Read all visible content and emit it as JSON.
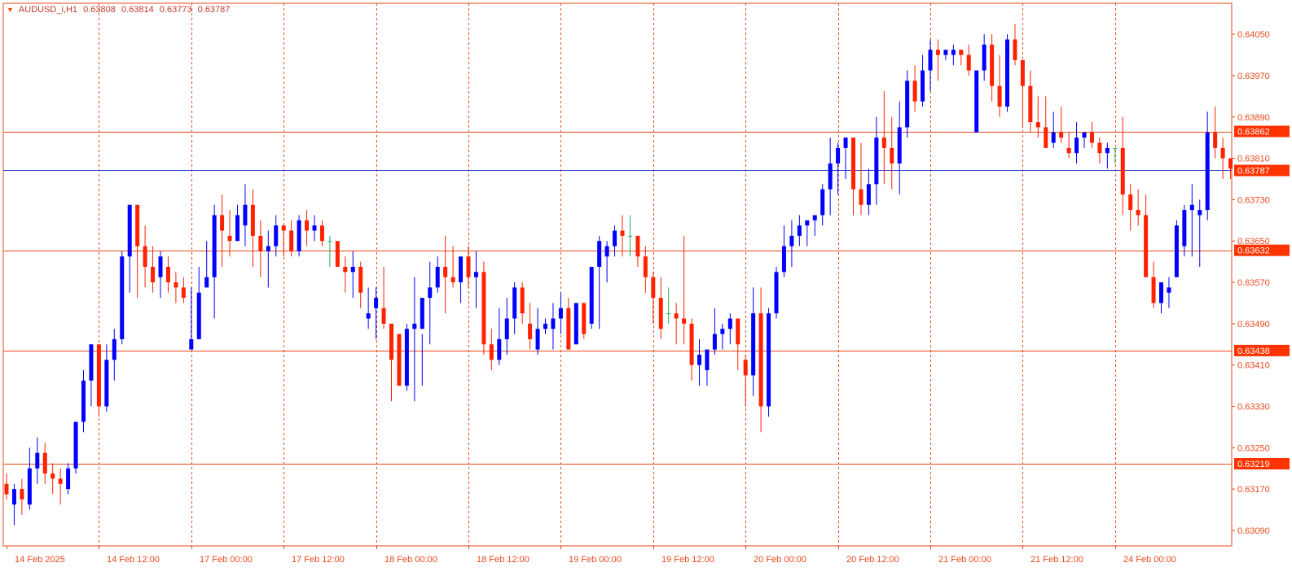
{
  "chart_header": {
    "symbol": "AUDUSD_i,H1",
    "open": "0.63808",
    "high": "0.63814",
    "low": "0.63773",
    "close": "0.63787",
    "collapse_icon": "triangle-down-icon"
  },
  "colors": {
    "background": "#ffffff",
    "frame": "#e8491d",
    "bull": "#0000ff",
    "bear": "#ff2200",
    "neutral": "#27ae60",
    "axis_text": "#e8491d",
    "level_line": "#e8491d",
    "price_line": "#3344cc",
    "badge_bg": "#ff3300",
    "badge_text": "#ffffff"
  },
  "chart_data": {
    "type": "candlestick",
    "x_labels": [
      "14 Feb 2025",
      "14 Feb 12:00",
      "17 Feb 00:00",
      "17 Feb 12:00",
      "18 Feb 00:00",
      "18 Feb 12:00",
      "19 Feb 00:00",
      "19 Feb 12:00",
      "20 Feb 00:00",
      "20 Feb 12:00",
      "21 Feb 00:00",
      "21 Feb 12:00",
      "24 Feb 00:00"
    ],
    "separator_indices": [
      12,
      24,
      36,
      48,
      60,
      72,
      84,
      96,
      108,
      120,
      132,
      144
    ],
    "y_ticks": [
      "0.63090",
      "0.63170",
      "0.63250",
      "0.63330",
      "0.63410",
      "0.63490",
      "0.63570",
      "0.63650",
      "0.63730",
      "0.63810",
      "0.63890",
      "0.63970",
      "0.64050"
    ],
    "ylim": [
      0.6306,
      0.6411
    ],
    "levels": [
      "0.63862",
      "0.63632",
      "0.63438",
      "0.63219"
    ],
    "current_price": "0.63787",
    "candles": [
      [
        0.6318,
        0.632,
        0.6315,
        0.6316
      ],
      [
        0.6314,
        0.6318,
        0.631,
        0.6317
      ],
      [
        0.6317,
        0.6319,
        0.6312,
        0.6315
      ],
      [
        0.6314,
        0.6325,
        0.6313,
        0.6321
      ],
      [
        0.6321,
        0.6327,
        0.6318,
        0.6324
      ],
      [
        0.6324,
        0.6326,
        0.6318,
        0.632
      ],
      [
        0.632,
        0.6322,
        0.6316,
        0.6319
      ],
      [
        0.6319,
        0.6321,
        0.6314,
        0.6318
      ],
      [
        0.6317,
        0.6322,
        0.6316,
        0.6321
      ],
      [
        0.6321,
        0.633,
        0.632,
        0.633
      ],
      [
        0.633,
        0.634,
        0.6328,
        0.6338
      ],
      [
        0.6338,
        0.6345,
        0.6333,
        0.6345
      ],
      [
        0.6345,
        0.6342,
        0.6331,
        0.6333
      ],
      [
        0.6333,
        0.6345,
        0.6332,
        0.6342
      ],
      [
        0.6342,
        0.6348,
        0.6338,
        0.6346
      ],
      [
        0.6346,
        0.6363,
        0.6345,
        0.6362
      ],
      [
        0.6362,
        0.6372,
        0.6355,
        0.6372
      ],
      [
        0.6372,
        0.637,
        0.6354,
        0.6364
      ],
      [
        0.6364,
        0.6368,
        0.6356,
        0.636
      ],
      [
        0.636,
        0.6364,
        0.6355,
        0.6357
      ],
      [
        0.6358,
        0.6363,
        0.6354,
        0.6362
      ],
      [
        0.636,
        0.6362,
        0.6355,
        0.6357
      ],
      [
        0.6357,
        0.6359,
        0.6353,
        0.6356
      ],
      [
        0.6356,
        0.6358,
        0.6353,
        0.6354
      ],
      [
        0.6344,
        0.6356,
        0.6345,
        0.6346
      ],
      [
        0.6346,
        0.636,
        0.6348,
        0.6355
      ],
      [
        0.6356,
        0.6365,
        0.6358,
        0.6358
      ],
      [
        0.6358,
        0.6372,
        0.635,
        0.637
      ],
      [
        0.637,
        0.6374,
        0.636,
        0.6367
      ],
      [
        0.6366,
        0.6371,
        0.6362,
        0.6365
      ],
      [
        0.6365,
        0.6372,
        0.6365,
        0.637
      ],
      [
        0.6368,
        0.6376,
        0.6364,
        0.6372
      ],
      [
        0.6372,
        0.6375,
        0.636,
        0.6366
      ],
      [
        0.6366,
        0.6369,
        0.6358,
        0.6363
      ],
      [
        0.6363,
        0.6367,
        0.6356,
        0.6364
      ],
      [
        0.6364,
        0.637,
        0.6362,
        0.6368
      ],
      [
        0.6368,
        0.6367,
        0.6362,
        0.6367
      ],
      [
        0.6367,
        0.6369,
        0.6362,
        0.6363
      ],
      [
        0.6363,
        0.637,
        0.6362,
        0.6369
      ],
      [
        0.6369,
        0.6371,
        0.6364,
        0.6367
      ],
      [
        0.6367,
        0.637,
        0.6365,
        0.6368
      ],
      [
        0.6368,
        0.6369,
        0.6364,
        0.6365
      ],
      [
        0.6365,
        0.6366,
        0.636,
        0.6365
      ],
      [
        0.6365,
        0.6362,
        0.636,
        0.636
      ],
      [
        0.636,
        0.6362,
        0.6355,
        0.6359
      ],
      [
        0.6359,
        0.6363,
        0.6354,
        0.636
      ],
      [
        0.636,
        0.6361,
        0.6352,
        0.6355
      ],
      [
        0.635,
        0.6356,
        0.6348,
        0.6351
      ],
      [
        0.6352,
        0.6356,
        0.6346,
        0.6354
      ],
      [
        0.6352,
        0.636,
        0.6348,
        0.6349
      ],
      [
        0.6349,
        0.6346,
        0.6334,
        0.6342
      ],
      [
        0.6347,
        0.6347,
        0.6337,
        0.6337
      ],
      [
        0.6337,
        0.6349,
        0.6336,
        0.6348
      ],
      [
        0.6348,
        0.6358,
        0.6334,
        0.6349
      ],
      [
        0.6348,
        0.6347,
        0.6337,
        0.6354
      ],
      [
        0.6354,
        0.6361,
        0.6345,
        0.6356
      ],
      [
        0.6356,
        0.6362,
        0.6355,
        0.636
      ],
      [
        0.636,
        0.6366,
        0.6351,
        0.6358
      ],
      [
        0.6358,
        0.6364,
        0.6356,
        0.6357
      ],
      [
        0.6357,
        0.636,
        0.6353,
        0.6362
      ],
      [
        0.6362,
        0.6364,
        0.6356,
        0.6358
      ],
      [
        0.6358,
        0.6363,
        0.6352,
        0.6359
      ],
      [
        0.6359,
        0.6361,
        0.6343,
        0.6345
      ],
      [
        0.6345,
        0.6348,
        0.634,
        0.6342
      ],
      [
        0.6342,
        0.6352,
        0.6341,
        0.6346
      ],
      [
        0.6346,
        0.6354,
        0.6343,
        0.635
      ],
      [
        0.635,
        0.6357,
        0.6347,
        0.6356
      ],
      [
        0.6356,
        0.6357,
        0.6349,
        0.6351
      ],
      [
        0.6349,
        0.6353,
        0.6344,
        0.6346
      ],
      [
        0.6344,
        0.6352,
        0.6343,
        0.6348
      ],
      [
        0.6348,
        0.635,
        0.6347,
        0.6349
      ],
      [
        0.6348,
        0.6353,
        0.6344,
        0.635
      ],
      [
        0.635,
        0.6355,
        0.6347,
        0.6352
      ],
      [
        0.6352,
        0.6354,
        0.6344,
        0.6344
      ],
      [
        0.6345,
        0.6352,
        0.6345,
        0.6353
      ],
      [
        0.6353,
        0.6353,
        0.6346,
        0.6347
      ],
      [
        0.6349,
        0.636,
        0.6348,
        0.636
      ],
      [
        0.636,
        0.6366,
        0.6348,
        0.6365
      ],
      [
        0.6362,
        0.6365,
        0.6357,
        0.6364
      ],
      [
        0.6364,
        0.6368,
        0.6362,
        0.6367
      ],
      [
        0.6367,
        0.637,
        0.6362,
        0.6366
      ],
      [
        0.6366,
        0.637,
        0.6362,
        0.6366
      ],
      [
        0.6366,
        0.6366,
        0.636,
        0.6362
      ],
      [
        0.6362,
        0.6364,
        0.6355,
        0.6358
      ],
      [
        0.6358,
        0.6359,
        0.6349,
        0.6354
      ],
      [
        0.6354,
        0.6358,
        0.6346,
        0.6348
      ],
      [
        0.6351,
        0.6356,
        0.6349,
        0.6351
      ],
      [
        0.6351,
        0.6353,
        0.6345,
        0.635
      ],
      [
        0.635,
        0.6366,
        0.6345,
        0.6349
      ],
      [
        0.6349,
        0.635,
        0.6338,
        0.6341
      ],
      [
        0.6341,
        0.6346,
        0.6337,
        0.6343
      ],
      [
        0.634,
        0.6344,
        0.6337,
        0.6344
      ],
      [
        0.6344,
        0.6352,
        0.6343,
        0.6347
      ],
      [
        0.6347,
        0.6349,
        0.6344,
        0.6348
      ],
      [
        0.6348,
        0.6351,
        0.6345,
        0.635
      ],
      [
        0.635,
        0.635,
        0.634,
        0.6345
      ],
      [
        0.6342,
        0.6343,
        0.6333,
        0.6339
      ],
      [
        0.6339,
        0.6356,
        0.6335,
        0.6351
      ],
      [
        0.6351,
        0.6356,
        0.6328,
        0.6333
      ],
      [
        0.6333,
        0.6352,
        0.6331,
        0.6351
      ],
      [
        0.6351,
        0.636,
        0.635,
        0.6359
      ],
      [
        0.6359,
        0.6368,
        0.6358,
        0.6364
      ],
      [
        0.6364,
        0.6369,
        0.636,
        0.6366
      ],
      [
        0.6366,
        0.637,
        0.6364,
        0.6368
      ],
      [
        0.6368,
        0.6368,
        0.6364,
        0.6369
      ],
      [
        0.6369,
        0.6369,
        0.6366,
        0.637
      ],
      [
        0.637,
        0.6376,
        0.6368,
        0.6375
      ],
      [
        0.6375,
        0.6385,
        0.637,
        0.638
      ],
      [
        0.638,
        0.6384,
        0.6374,
        0.6383
      ],
      [
        0.6383,
        0.6385,
        0.6377,
        0.6385
      ],
      [
        0.6385,
        0.6384,
        0.637,
        0.6375
      ],
      [
        0.6375,
        0.6384,
        0.637,
        0.6372
      ],
      [
        0.6372,
        0.6379,
        0.637,
        0.6376
      ],
      [
        0.6376,
        0.6389,
        0.6372,
        0.6385
      ],
      [
        0.6385,
        0.6394,
        0.6376,
        0.6383
      ],
      [
        0.6383,
        0.6389,
        0.6375,
        0.638
      ],
      [
        0.638,
        0.6392,
        0.6374,
        0.6387
      ],
      [
        0.6387,
        0.6398,
        0.6385,
        0.6396
      ],
      [
        0.6396,
        0.6399,
        0.639,
        0.6392
      ],
      [
        0.6392,
        0.6401,
        0.6391,
        0.6398
      ],
      [
        0.6398,
        0.6404,
        0.6394,
        0.6402
      ],
      [
        0.6402,
        0.6404,
        0.6396,
        0.6401
      ],
      [
        0.6401,
        0.6401,
        0.64,
        0.6402
      ],
      [
        0.6401,
        0.6403,
        0.6399,
        0.6402
      ],
      [
        0.6402,
        0.6402,
        0.6399,
        0.6401
      ],
      [
        0.6401,
        0.6403,
        0.6397,
        0.6398
      ],
      [
        0.6386,
        0.6398,
        0.6386,
        0.6398
      ],
      [
        0.6398,
        0.6405,
        0.6396,
        0.6403
      ],
      [
        0.6403,
        0.6405,
        0.6392,
        0.6395
      ],
      [
        0.6395,
        0.6401,
        0.6389,
        0.6391
      ],
      [
        0.6391,
        0.6405,
        0.639,
        0.6404
      ],
      [
        0.6404,
        0.6407,
        0.6399,
        0.64
      ],
      [
        0.64,
        0.64,
        0.6387,
        0.6395
      ],
      [
        0.6395,
        0.6398,
        0.6386,
        0.6388
      ],
      [
        0.6388,
        0.6393,
        0.6385,
        0.6387
      ],
      [
        0.6387,
        0.6393,
        0.6383,
        0.6383
      ],
      [
        0.6384,
        0.639,
        0.6383,
        0.6386
      ],
      [
        0.6386,
        0.6391,
        0.6384,
        0.6385
      ],
      [
        0.6383,
        0.6386,
        0.6381,
        0.6382
      ],
      [
        0.6382,
        0.6388,
        0.638,
        0.6385
      ],
      [
        0.6385,
        0.6386,
        0.6383,
        0.6386
      ],
      [
        0.6386,
        0.6388,
        0.6383,
        0.6384
      ],
      [
        0.6384,
        0.6385,
        0.638,
        0.6382
      ],
      [
        0.6382,
        0.6384,
        0.6379,
        0.6383
      ],
      [
        0.6383,
        0.6383,
        0.638,
        0.6383
      ],
      [
        0.6383,
        0.6389,
        0.637,
        0.6374
      ],
      [
        0.6374,
        0.6376,
        0.6367,
        0.6371
      ],
      [
        0.6371,
        0.6375,
        0.6368,
        0.637
      ],
      [
        0.637,
        0.6374,
        0.6358,
        0.6358
      ],
      [
        0.6358,
        0.6361,
        0.6352,
        0.6353
      ],
      [
        0.6353,
        0.6356,
        0.6351,
        0.6357
      ],
      [
        0.6355,
        0.6358,
        0.6352,
        0.6356
      ],
      [
        0.6358,
        0.6369,
        0.6358,
        0.6368
      ],
      [
        0.6364,
        0.6372,
        0.6362,
        0.6371
      ],
      [
        0.6371,
        0.6376,
        0.6362,
        0.6372
      ],
      [
        0.637,
        0.6373,
        0.636,
        0.6371
      ],
      [
        0.6371,
        0.639,
        0.6369,
        0.6386
      ],
      [
        0.6386,
        0.6391,
        0.6381,
        0.6383
      ],
      [
        0.6383,
        0.6385,
        0.6377,
        0.6381
      ],
      [
        0.6381,
        0.6381,
        0.6377,
        0.6379
      ]
    ]
  }
}
